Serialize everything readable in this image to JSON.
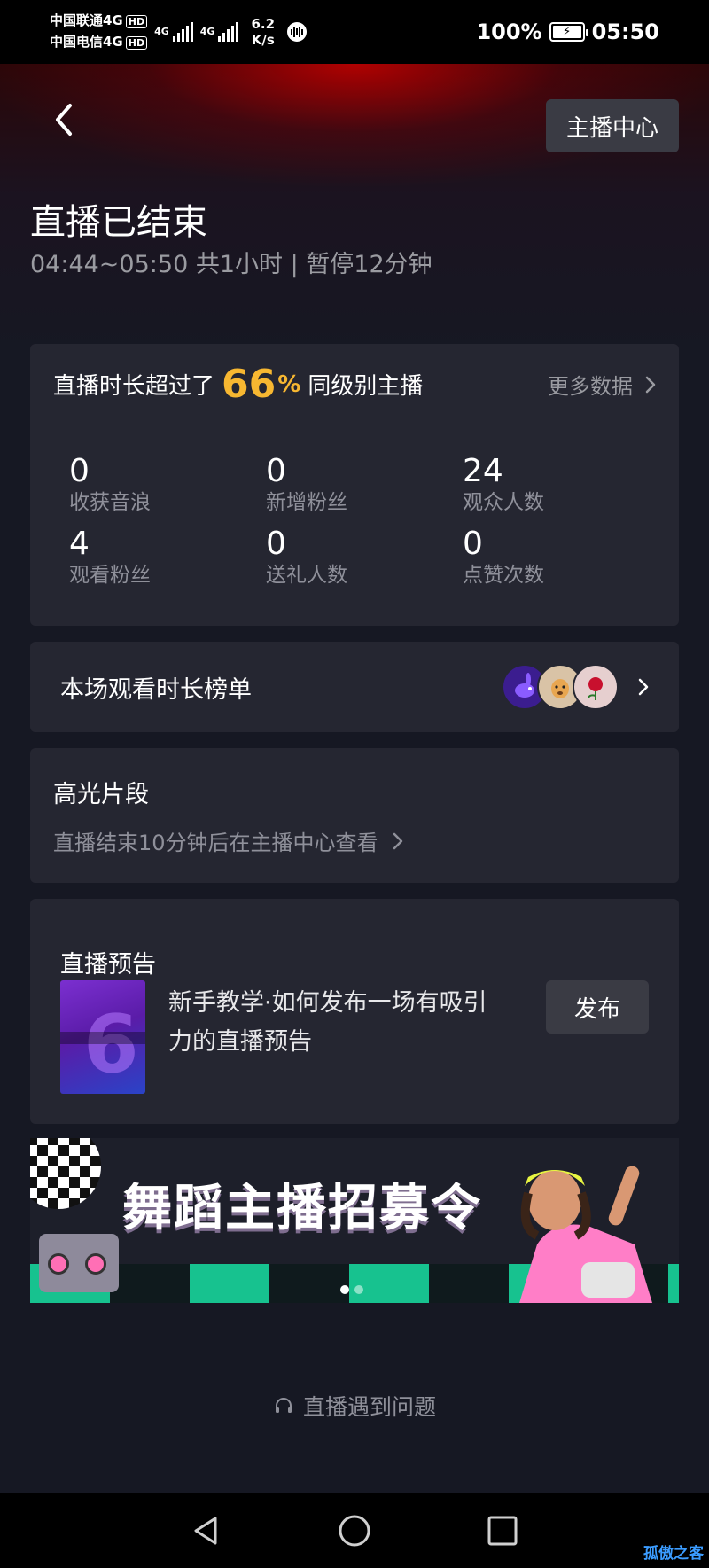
{
  "status_bar": {
    "carrier1": "中国联通4G",
    "carrier2": "中国电信4G",
    "hd": "HD",
    "net_type": "4G",
    "speed_value": "6.2",
    "speed_unit": "K/s",
    "battery": "100%",
    "time": "05:50"
  },
  "header": {
    "anchor_center_label": "主播中心",
    "title": "直播已结束",
    "subtitle": "04:44~05:50 共1小时 | 暂停12分钟"
  },
  "stats": {
    "headline_prefix": "直播时长超过了",
    "headline_percent": "66",
    "headline_percent_sign": "%",
    "headline_suffix": "同级别主播",
    "more_data_label": "更多数据",
    "items": [
      {
        "value": "0",
        "label": "收获音浪"
      },
      {
        "value": "0",
        "label": "新增粉丝"
      },
      {
        "value": "24",
        "label": "观众人数"
      },
      {
        "value": "4",
        "label": "观看粉丝"
      },
      {
        "value": "0",
        "label": "送礼人数"
      },
      {
        "value": "0",
        "label": "点赞次数"
      }
    ]
  },
  "ranking": {
    "title": "本场观看时长榜单",
    "avatar_icons": [
      "rabbit-avatar-icon",
      "dog-avatar-icon",
      "rose-avatar-icon"
    ]
  },
  "highlight": {
    "title": "高光片段",
    "description": "直播结束10分钟后在主播中心查看"
  },
  "preview": {
    "title": "直播预告",
    "tutorial_text": "新手教学·如何发布一场有吸引力的直播预告",
    "publish_label": "发布"
  },
  "banner": {
    "text": "舞蹈主播招募令",
    "slide_count": 2,
    "active_slide": 1
  },
  "help": {
    "label": "直播遇到问题"
  },
  "watermark": "孤傲之客",
  "colors": {
    "background": "#161823",
    "card": "#252631",
    "accent_percent": "#f7b731",
    "muted_text": "#8f909a"
  }
}
